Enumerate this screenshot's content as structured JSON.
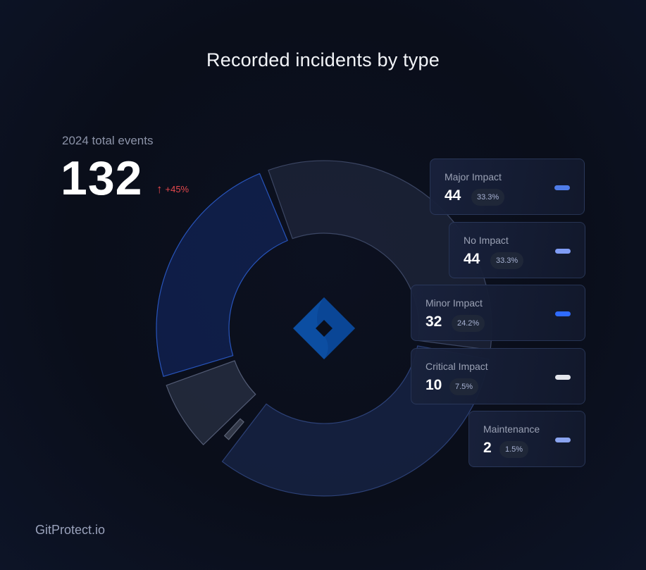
{
  "title": "Recorded incidents by type",
  "summary": {
    "label": "2024 total events",
    "total": "132",
    "trend_icon": "arrow-up-icon",
    "trend": "+45%",
    "trend_color": "#e5484d"
  },
  "center_logo": "jira-diamond-logo",
  "brand": "GitProtect.io",
  "chart_data": {
    "type": "pie",
    "variant": "donut",
    "title": "Recorded incidents by type",
    "total": 132,
    "slices": [
      {
        "name": "Major Impact",
        "value": 44,
        "percent": "33.3%",
        "color": "#4f7ce8"
      },
      {
        "name": "No Impact",
        "value": 44,
        "percent": "33.3%",
        "color": "#7f9cf5"
      },
      {
        "name": "Minor Impact",
        "value": 32,
        "percent": "24.2%",
        "color": "#2f6bff"
      },
      {
        "name": "Critical Impact",
        "value": 10,
        "percent": "7.5%",
        "color": "#e4e6ec"
      },
      {
        "name": "Maintenance",
        "value": 2,
        "percent": "1.5%",
        "color": "#8aa4f0"
      }
    ],
    "legend_position": "right"
  }
}
